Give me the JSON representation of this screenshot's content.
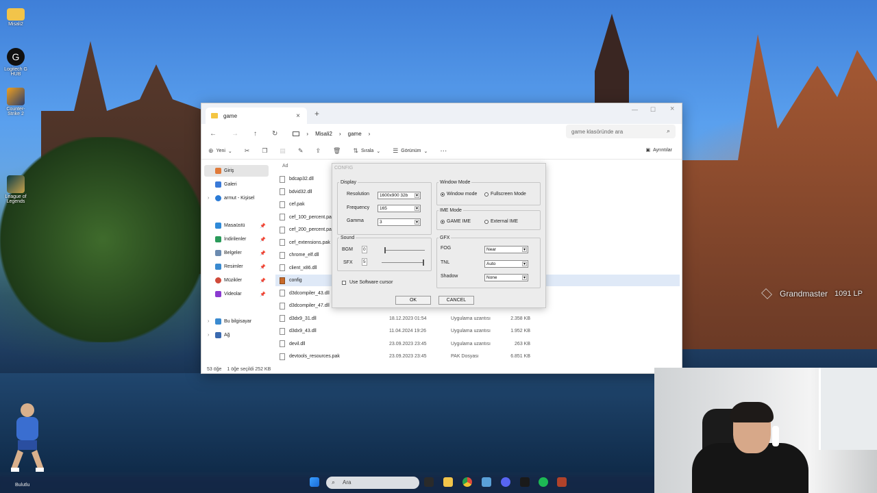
{
  "desktop_icons": [
    {
      "label": "Misali2"
    },
    {
      "label": "Logitech G HUB"
    },
    {
      "label": "Counter-Strike 2"
    },
    {
      "label": "League of Legends"
    }
  ],
  "explorer": {
    "tab_title": "game",
    "breadcrumb": [
      "Misali2",
      "game"
    ],
    "search_placeholder": "game klasöründe ara",
    "toolbar": {
      "new": "Yeni",
      "sort": "Sırala",
      "view": "Görünüm",
      "more": "···",
      "details": "Ayrıntılar"
    },
    "sidebar": [
      {
        "label": "Giriş",
        "icon": "home-icon"
      },
      {
        "label": "Galeri",
        "icon": "gallery-icon"
      },
      {
        "label": "armut - Kişisel",
        "icon": "cloud-icon"
      },
      {
        "label": "Masaüstü",
        "icon": "desktop-icon"
      },
      {
        "label": "İndirilenler",
        "icon": "download-icon"
      },
      {
        "label": "Belgeler",
        "icon": "documents-icon"
      },
      {
        "label": "Resimler",
        "icon": "pictures-icon"
      },
      {
        "label": "Müzikler",
        "icon": "music-icon"
      },
      {
        "label": "Videolar",
        "icon": "videos-icon"
      },
      {
        "label": "Bu bilgisayar",
        "icon": "pc-icon"
      },
      {
        "label": "Ağ",
        "icon": "network-icon"
      }
    ],
    "column_name": "Ad",
    "files": [
      {
        "name": "bdcap32.dll",
        "date": "",
        "type": "",
        "size": ""
      },
      {
        "name": "bdvid32.dll",
        "date": "",
        "type": "",
        "size": ""
      },
      {
        "name": "cef.pak",
        "date": "",
        "type": "",
        "size": ""
      },
      {
        "name": "cef_100_percent.pak",
        "date": "",
        "type": "",
        "size": ""
      },
      {
        "name": "cef_200_percent.pak",
        "date": "",
        "type": "",
        "size": ""
      },
      {
        "name": "cef_extensions.pak",
        "date": "",
        "type": "",
        "size": ""
      },
      {
        "name": "chrome_elf.dll",
        "date": "",
        "type": "",
        "size": ""
      },
      {
        "name": "client_x86.dll",
        "date": "",
        "type": "",
        "size": ""
      },
      {
        "name": "config",
        "date": "",
        "type": "",
        "size": ""
      },
      {
        "name": "d3dcompiler_43.dll",
        "date": "",
        "type": "",
        "size": ""
      },
      {
        "name": "d3dcompiler_47.dll",
        "date": "",
        "type": "",
        "size": ""
      },
      {
        "name": "d3dx9_31.dll",
        "date": "18.12.2023 01:54",
        "type": "Uygulama uzantısı",
        "size": "2.358 KB"
      },
      {
        "name": "d3dx9_43.dll",
        "date": "11.04.2024 19:26",
        "type": "Uygulama uzantısı",
        "size": "1.952 KB"
      },
      {
        "name": "devil.dll",
        "date": "23.09.2023 23:45",
        "type": "Uygulama uzantısı",
        "size": "263 KB"
      },
      {
        "name": "devtools_resources.pak",
        "date": "23.09.2023 23:45",
        "type": "PAK Dosyası",
        "size": "6.851 KB"
      }
    ],
    "status": {
      "count": "53 öğe",
      "selection": "1 öğe seçildi  252 KB"
    }
  },
  "config": {
    "title": "CONFIG",
    "display": {
      "legend": "Display",
      "resolution_label": "Resolution",
      "resolution_value": "1600x900 32b",
      "frequency_label": "Frequency",
      "frequency_value": "165",
      "gamma_label": "Gamma",
      "gamma_value": "3"
    },
    "window_mode": {
      "legend": "Window Mode",
      "opt_window": "Window mode",
      "opt_fullscreen": "Fullscreen Mode",
      "selected": "window"
    },
    "ime_mode": {
      "legend": "IME Mode",
      "opt_game": "GAME IME",
      "opt_external": "External IME",
      "selected": "game"
    },
    "sound": {
      "legend": "Sound",
      "bgm_label": "BGM",
      "bgm_value": "0",
      "sfx_label": "SFX",
      "sfx_value": "5",
      "bgm_level": 0.0,
      "sfx_level": 1.0
    },
    "gfx": {
      "legend": "GFX",
      "fog_label": "FOG",
      "fog_value": "Near",
      "tnl_label": "TNL",
      "tnl_value": "Auto",
      "shadow_label": "Shadow",
      "shadow_value": "None"
    },
    "software_cursor_label": "Use Software cursor",
    "ok": "OK",
    "cancel": "CANCEL"
  },
  "overlay": {
    "rank": "Grandmaster",
    "lp": "1091 LP"
  },
  "taskbar": {
    "search": "Ara",
    "weather": "Bulutlu"
  }
}
